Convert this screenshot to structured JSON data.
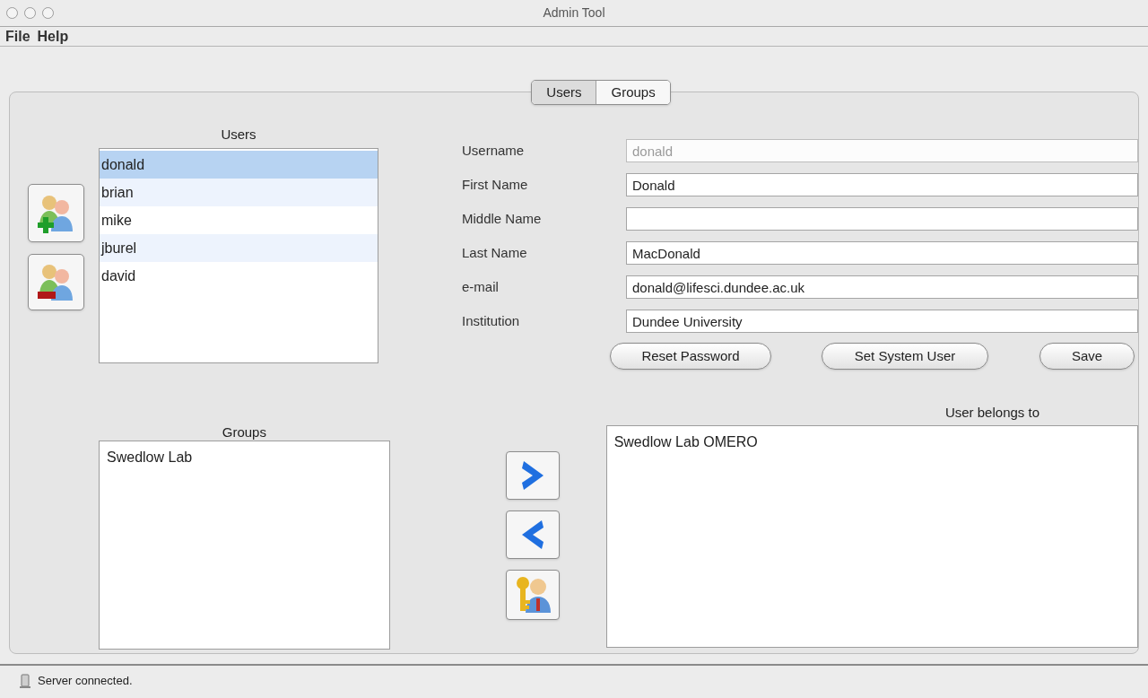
{
  "window": {
    "title": "Admin Tool"
  },
  "menu": [
    "File",
    "Help"
  ],
  "tabs": [
    {
      "label": "Users",
      "selected": true
    },
    {
      "label": "Groups",
      "selected": false
    }
  ],
  "users": {
    "heading": "Users",
    "items": [
      {
        "label": "donald",
        "selected": true
      },
      {
        "label": "brian",
        "selected": false
      },
      {
        "label": "mike",
        "selected": false
      },
      {
        "label": "jburel",
        "selected": false
      },
      {
        "label": "david",
        "selected": false
      }
    ]
  },
  "form": {
    "fields": [
      {
        "label": "Username",
        "value": "donald",
        "disabled": true
      },
      {
        "label": "First Name",
        "value": "Donald",
        "disabled": false
      },
      {
        "label": "Middle Name",
        "disabled": false
      },
      {
        "label": "Last Name",
        "value": "MacDonald",
        "disabled": false
      },
      {
        "label": "e-mail",
        "value": "donald@lifesci.dundee.ac.uk",
        "disabled": false
      },
      {
        "label": "Institution",
        "value": "Dundee University",
        "disabled": false
      }
    ],
    "buttons": [
      "Reset Password",
      "Set System User",
      "Save"
    ]
  },
  "groups": {
    "heading": "Groups",
    "items": [
      "Swedlow Lab"
    ]
  },
  "membership": {
    "heading": "User belongs to",
    "items": [
      "Swedlow Lab OMERO"
    ]
  },
  "status_bar": {
    "text": "Server connected."
  }
}
